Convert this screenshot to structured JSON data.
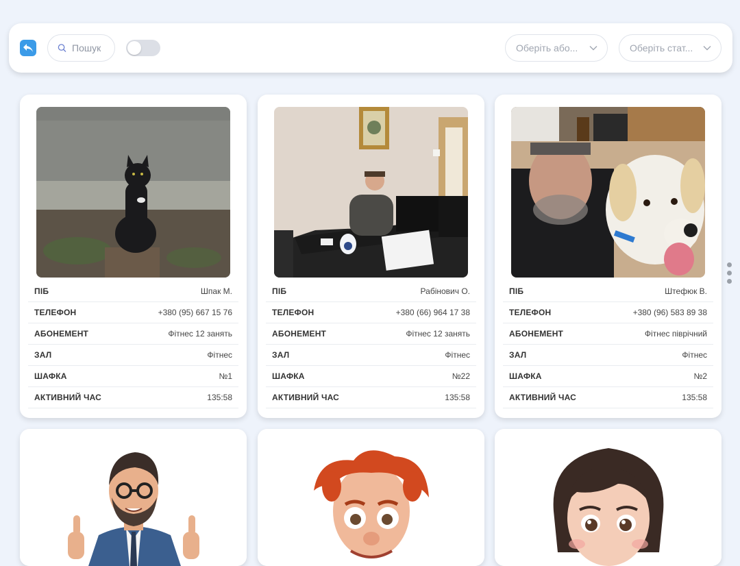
{
  "toolbar": {
    "search_placeholder": "Пошук",
    "subscription_select": "Оберіть або...",
    "status_select": "Оберіть стат...",
    "toggle_on": false
  },
  "labels": {
    "name": "ПІБ",
    "phone": "ТЕЛЕФОН",
    "subscription": "АБОНЕМЕНТ",
    "hall": "ЗАЛ",
    "locker": "ШАФКА",
    "active_time": "АКТИВНИЙ ЧАС"
  },
  "clients": [
    {
      "name": "Шпак М.",
      "phone": "+380 (95) 667 15 76",
      "subscription": "Фітнес 12 занять",
      "hall": "Фітнес",
      "locker": "№1",
      "active_time": "135:58"
    },
    {
      "name": "Рабінович О.",
      "phone": "+380 (66) 964 17 38",
      "subscription": "Фітнес 12 занять",
      "hall": "Фітнес",
      "locker": "№22",
      "active_time": "135:58"
    },
    {
      "name": "Штефюк В.",
      "phone": "+380 (96) 583 89 38",
      "subscription": "Фітнес піврічний",
      "hall": "Фітнес",
      "locker": "№2",
      "active_time": "135:58"
    }
  ],
  "colors": {
    "accent": "#3b9be8",
    "background": "#eef3fb"
  }
}
